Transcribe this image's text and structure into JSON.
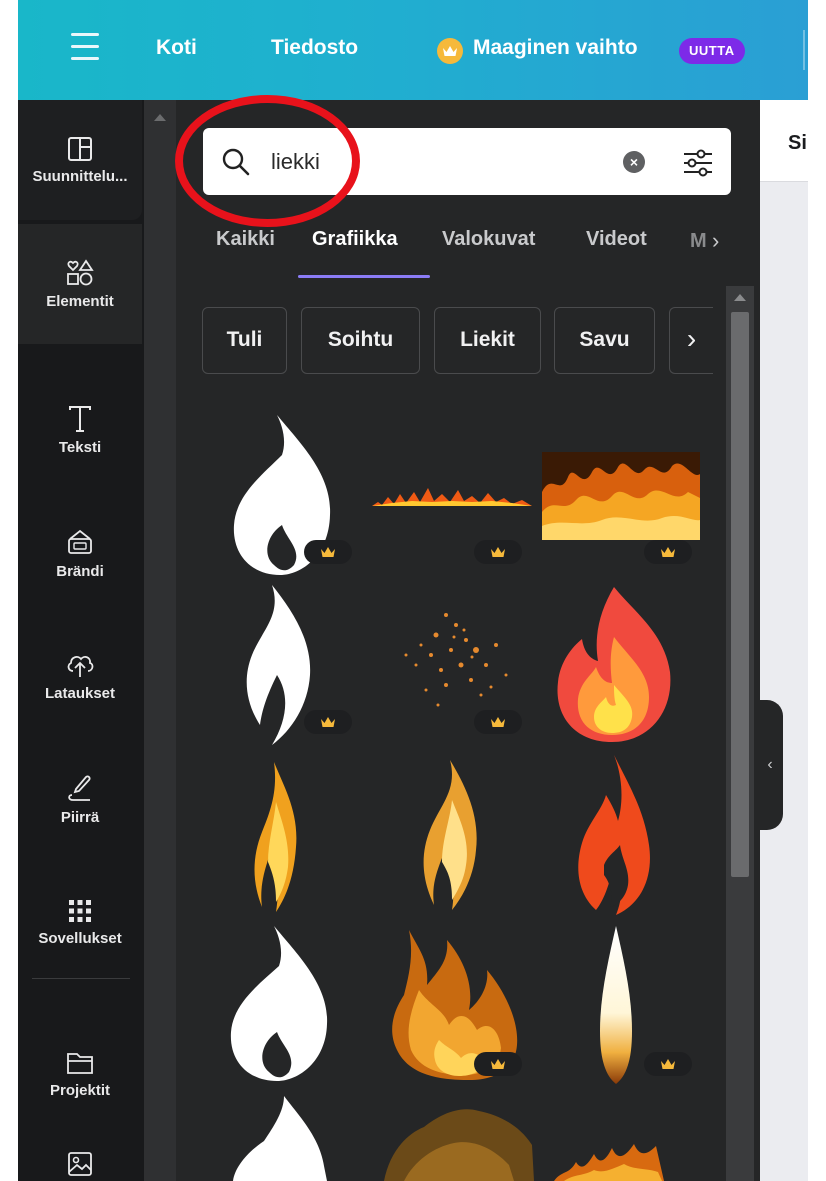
{
  "topbar": {
    "menu_icon": "hamburger-icon",
    "nav": [
      "Koti",
      "Tiedosto"
    ],
    "magic_label": "Maaginen vaihto",
    "new_badge": "UUTTA",
    "gradient_colors": [
      "#19b7c9",
      "#2a9fd4"
    ]
  },
  "sidebar": {
    "items": [
      {
        "label": "Suunnittelu...",
        "icon": "layout-icon"
      },
      {
        "label": "Elementit",
        "icon": "elements-icon"
      },
      {
        "label": "Teksti",
        "icon": "text-icon"
      },
      {
        "label": "Brändi",
        "icon": "brand-kit-icon"
      },
      {
        "label": "Lataukset",
        "icon": "cloud-upload-icon"
      },
      {
        "label": "Piirrä",
        "icon": "draw-icon"
      },
      {
        "label": "Sovellukset",
        "icon": "apps-grid-icon"
      },
      {
        "label": "Projektit",
        "icon": "folder-icon"
      },
      {
        "label": "",
        "icon": "image-icon"
      }
    ]
  },
  "search": {
    "value": "liekki",
    "clear_icon": "clear-icon",
    "filter_icon": "filter-sliders-icon"
  },
  "tabs": {
    "items": [
      "Kaikki",
      "Grafiikka",
      "Valokuvat",
      "Videot"
    ],
    "active": "Grafiikka",
    "overflow": "M"
  },
  "chips": [
    "Tuli",
    "Soihtu",
    "Liekit",
    "Savu"
  ],
  "canvas": {
    "header_text": "Si"
  },
  "colors": {
    "accent": "#8b7cf6",
    "badge": "#7d2ae8",
    "crown": "#f6b93b",
    "annotation": "#e8121b"
  }
}
